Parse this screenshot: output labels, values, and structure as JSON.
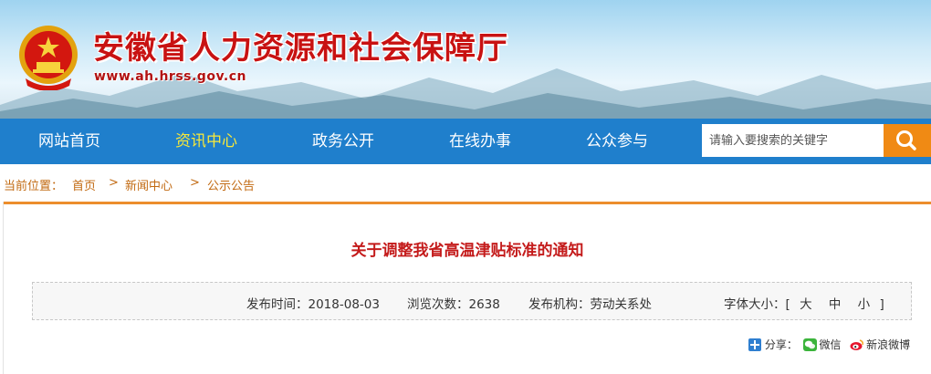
{
  "header": {
    "title": "安徽省人力资源和社会保障厅",
    "url": "www.ah.hrss.gov.cn"
  },
  "nav": {
    "items": [
      {
        "label": "网站首页"
      },
      {
        "label": "资讯中心"
      },
      {
        "label": "政务公开"
      },
      {
        "label": "在线办事"
      },
      {
        "label": "公众参与"
      }
    ],
    "active_color": "#f7e83a",
    "bar_color": "#1f7fcc"
  },
  "search": {
    "placeholder": "请输入要搜索的关键字",
    "button_color": "#f08a14",
    "icon": "search-icon"
  },
  "breadcrumb": {
    "prefix": "当前位置：",
    "items": [
      "首页",
      "新闻中心",
      "公示公告"
    ],
    "separator": ">"
  },
  "article": {
    "title": "关于调整我省高温津贴标准的通知",
    "publish_time": "发布时间：2018-08-03",
    "views": "浏览次数：2638",
    "publisher": "发布机构：劳动关系处",
    "font_size_label": "字体大小：[",
    "font_large": "大",
    "font_medium": "中",
    "font_small": "小",
    "font_close": "]"
  },
  "share": {
    "label": "分享：",
    "wechat": "微信",
    "weibo": "新浪微博"
  }
}
